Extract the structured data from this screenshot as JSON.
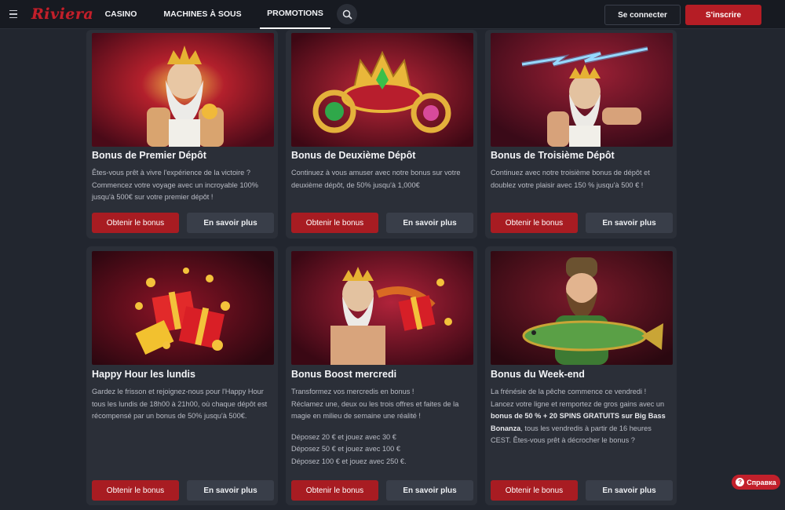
{
  "header": {
    "logo": "Riviera",
    "nav": [
      {
        "label": "CASINO"
      },
      {
        "label": "MACHINES À SOUS"
      },
      {
        "label": "PROMOTIONS"
      }
    ],
    "login_label": "Se connecter",
    "signup_label": "S'inscrire"
  },
  "cards": [
    {
      "title": "Bonus de Premier Dépôt",
      "desc": "Êtes-vous prêt à vivre l'expérience de la victoire ? Commencez votre voyage avec un incroyable 100% jusqu'à 500€ sur votre premier dépôt !",
      "image": "zeus-gold",
      "bonus_label": "Obtenir le bonus",
      "more_label": "En savoir plus"
    },
    {
      "title": "Bonus de Deuxième Dépôt",
      "desc": "Continuez à vous amuser avec notre bonus sur votre deuxième dépôt, de 50% jusqu'à 1,000€",
      "image": "crown-rings",
      "bonus_label": "Obtenir le bonus",
      "more_label": "En savoir plus"
    },
    {
      "title": "Bonus de Troisième Dépôt",
      "desc": "Continuez avec notre troisième bonus de dépôt et doublez votre plaisir avec 150 % jusqu'à 500 € !",
      "image": "zeus-lightning",
      "bonus_label": "Obtenir le bonus",
      "more_label": "En savoir plus"
    },
    {
      "title": "Happy Hour les lundis",
      "desc": "Gardez le frisson et rejoignez-nous pour l'Happy Hour tous les lundis de 18h00 à 21h00, où chaque dépôt est récompensé par un bonus de 50% jusqu'à 500€.",
      "image": "gift-boxes",
      "bonus_label": "Obtenir le bonus",
      "more_label": "En savoir plus"
    },
    {
      "title": "Bonus Boost mercredi",
      "desc_lines": [
        "Transformez vos mercredis en bonus !",
        "Réclamez une, deux ou les trois offres et faites de la magie en milieu de semaine une réalité !",
        "",
        "Déposez 20 € et jouez avec 30 €",
        "Déposez 50 € et jouez avec 100 €",
        "Déposez 100 € et jouez avec 250 €."
      ],
      "image": "zeus-gift",
      "bonus_label": "Obtenir le bonus",
      "more_label": "En savoir plus"
    },
    {
      "title": "Bonus du Week-end",
      "desc_parts": {
        "p1": "La frénésie de la pêche commence ce vendredi !",
        "p2": "Lancez votre ligne et remportez de gros gains avec un ",
        "bold": "bonus de 50 % + 20 SPINS GRATUITS sur Big Bass Bonanza",
        "p3": ", tous les vendredis à partir de 16 heures CEST. Êtes-vous prêt à décrocher le bonus ?"
      },
      "image": "fisherman",
      "bonus_label": "Obtenir le bonus",
      "more_label": "En savoir plus"
    }
  ],
  "help": {
    "label": "Справка"
  },
  "colors": {
    "accent": "#b51d25",
    "bg": "#22262f",
    "card": "#2b2f38",
    "header": "#171a21"
  }
}
